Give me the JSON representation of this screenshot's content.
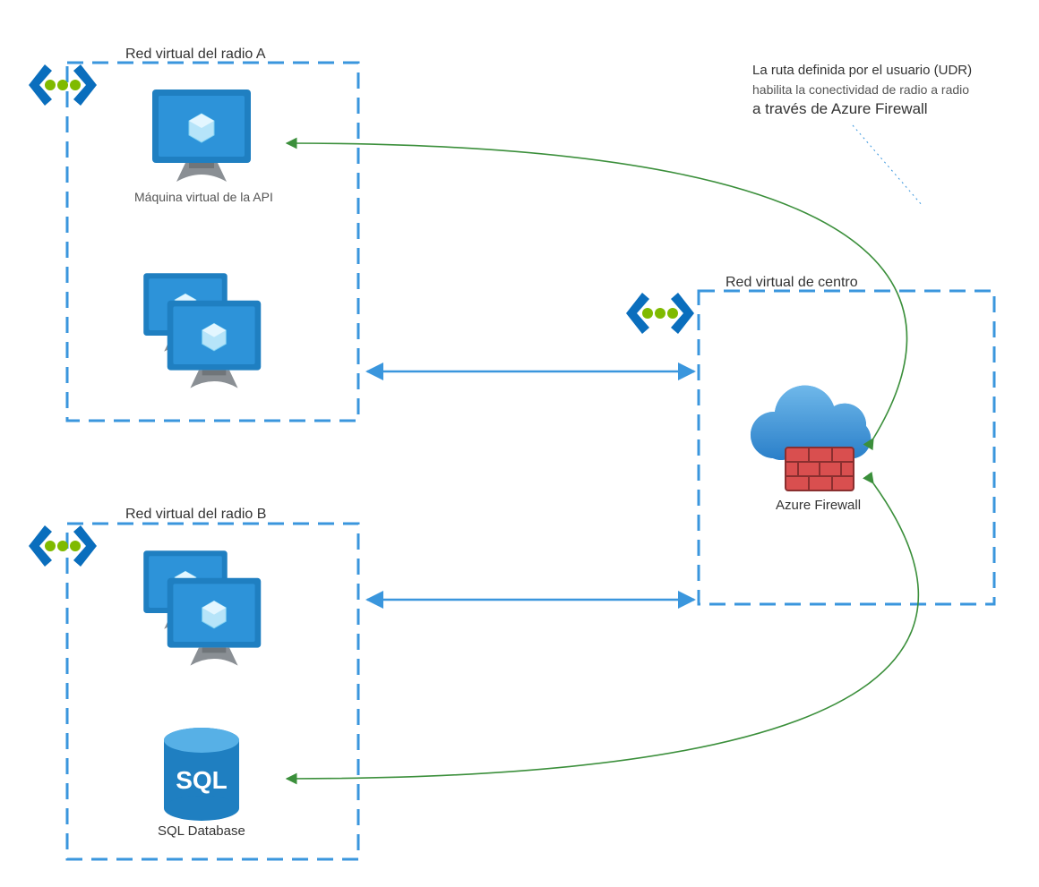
{
  "spokeA": {
    "title": "Red virtual del radio A",
    "vm_label": "Máquina virtual de la API"
  },
  "spokeB": {
    "title": "Red virtual del radio B",
    "sql_label": "SQL Database"
  },
  "hub": {
    "title": "Red virtual de centro",
    "firewall_label": "Azure Firewall"
  },
  "udr": {
    "line1": "La ruta definida por el usuario (UDR)",
    "line2": "habilita la conectividad de radio a radio",
    "line3": "a través de Azure Firewall"
  },
  "colors": {
    "blue": "#3a96dd",
    "dark_blue": "#0a6ebd",
    "green_dot": "#7fba00",
    "green_arrow": "#3b8f3b",
    "dash": "#3a96dd",
    "brick": "#d94f4f",
    "brick_dark": "#b43a3a"
  }
}
